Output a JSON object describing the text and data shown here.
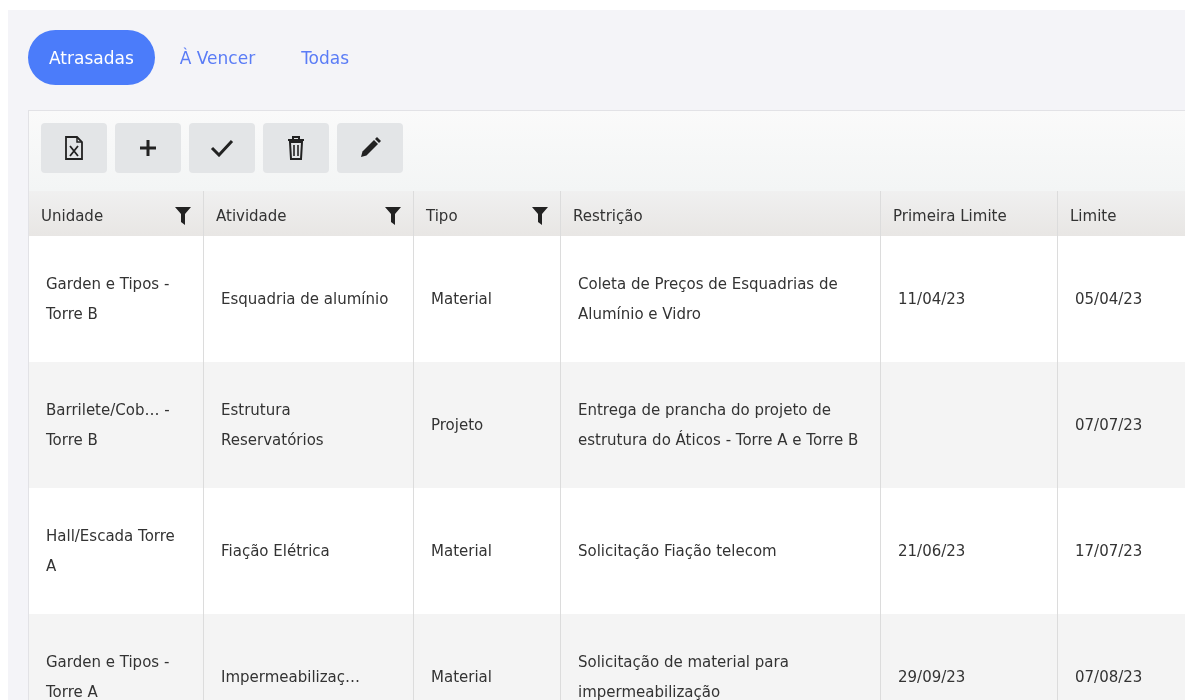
{
  "tabs": [
    {
      "label": "Atrasadas",
      "selected": true
    },
    {
      "label": "À Vencer",
      "selected": false
    },
    {
      "label": "Todas",
      "selected": false
    }
  ],
  "toolbar": [
    {
      "kind": "excel"
    },
    {
      "kind": "add"
    },
    {
      "kind": "check"
    },
    {
      "kind": "delete"
    },
    {
      "kind": "edit"
    }
  ],
  "table": {
    "columns": [
      {
        "label": "Unidade",
        "filter": true
      },
      {
        "label": "Atividade",
        "filter": true
      },
      {
        "label": "Tipo",
        "filter": true
      },
      {
        "label": "Restrição",
        "filter": false
      },
      {
        "label": "Primeira Limite",
        "filter": false
      },
      {
        "label": "Limite",
        "filter": false
      }
    ],
    "rows": [
      [
        "Garden e Tipos - Torre B",
        "Esquadria de alumínio",
        "Material",
        "Coleta de Preços de Esquadrias de Alumínio e Vidro",
        "11/04/23",
        "05/04/23"
      ],
      [
        "Barrilete/Cob… - Torre B",
        "Estrutura Reservatórios",
        "Projeto",
        "Entrega de prancha do projeto de estrutura do Áticos - Torre A e Torre B",
        "",
        "07/07/23"
      ],
      [
        "Hall/Escada Torre A",
        "Fiação Elétrica",
        "Material",
        "Solicitação Fiação telecom",
        "21/06/23",
        "17/07/23"
      ],
      [
        "Garden e Tipos - Torre A",
        "Impermeabilizaç…",
        "Material",
        "Solicitação de material para impermeabilização",
        "29/09/23",
        "07/08/23"
      ]
    ]
  }
}
